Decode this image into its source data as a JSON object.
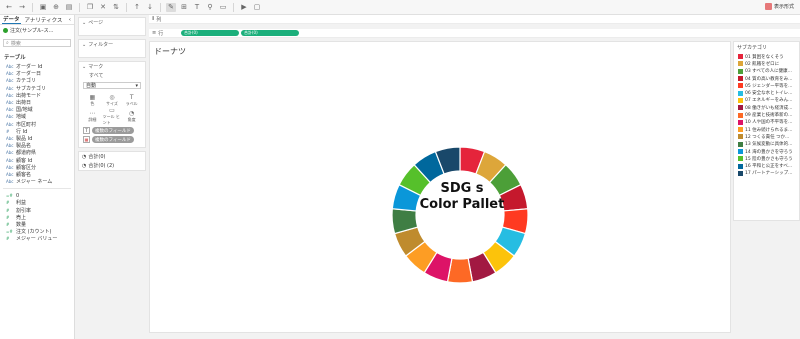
{
  "toolbar": {
    "buttons": [
      "back-icon",
      "forward-icon",
      "save-icon",
      "add-datasource-icon",
      "new-sheet-icon",
      "duplicate-icon",
      "clear-icon",
      "swap-icon",
      "sort-asc-icon",
      "sort-desc-icon",
      "highlight-icon",
      "group-icon",
      "label-icon",
      "fix-axes-icon",
      "fit-icon",
      "present-icon",
      "tooltip-icon"
    ],
    "show_me": "表示形式"
  },
  "data_pane": {
    "tabs": [
      "データ",
      "アナリティクス"
    ],
    "source": "注文(サンプル-ス...",
    "search_placeholder": "検索",
    "table_heading": "テーブル",
    "dimensions": [
      {
        "icon": "Abc",
        "label": "オーダー Id"
      },
      {
        "icon": "Abc",
        "label": "オーダー日"
      },
      {
        "icon": "Abc",
        "label": "カテゴリ"
      },
      {
        "icon": "Abc",
        "label": "サブカテゴリ"
      },
      {
        "icon": "Abc",
        "label": "出荷モード"
      },
      {
        "icon": "Abc",
        "label": "出荷日"
      },
      {
        "icon": "Abc",
        "label": "国/地域"
      },
      {
        "icon": "Abc",
        "label": "地域"
      },
      {
        "icon": "Abc",
        "label": "市区町村"
      },
      {
        "icon": "#",
        "label": "行 Id"
      },
      {
        "icon": "Abc",
        "label": "製品 Id"
      },
      {
        "icon": "Abc",
        "label": "製品名"
      },
      {
        "icon": "Abc",
        "label": "都道府県"
      },
      {
        "icon": "Abc",
        "label": "顧客 Id"
      },
      {
        "icon": "Abc",
        "label": "顧客区分"
      },
      {
        "icon": "Abc",
        "label": "顧客名"
      },
      {
        "icon": "Abc",
        "label": "メジャー ネーム"
      }
    ],
    "measures": [
      {
        "icon": "=#",
        "label": "0"
      },
      {
        "icon": "#",
        "label": "利益"
      },
      {
        "icon": "#",
        "label": "割引率"
      },
      {
        "icon": "#",
        "label": "売上"
      },
      {
        "icon": "#",
        "label": "数量"
      },
      {
        "icon": "=#",
        "label": "注文 (カウント)"
      },
      {
        "icon": "#",
        "label": "メジャー バリュー"
      }
    ]
  },
  "shelves": {
    "pages": "ページ",
    "filters": "フィルター",
    "marks": "マーク",
    "marks_all": "すべて",
    "mark_type": "自動",
    "mark_buttons": [
      {
        "sym": "▦",
        "label": "色"
      },
      {
        "sym": "◎",
        "label": "サイズ"
      },
      {
        "sym": "T",
        "label": "ラベル"
      },
      {
        "sym": "⋯",
        "label": "詳細"
      },
      {
        "sym": "▭",
        "label": "ツール ヒント"
      },
      {
        "sym": "◔",
        "label": "角度"
      }
    ],
    "pill1": "複数のフィールド",
    "pill2": "複数のフィールド",
    "sum1": "合計(0)",
    "sum2": "合計(0) (2)",
    "columns_label": "列",
    "rows_label": "行",
    "rows_pills": [
      "合計(0)",
      "合計(0)"
    ]
  },
  "sheet": {
    "title": "ドーナツ",
    "center_line1": "SDG s",
    "center_line2": "Color Pallet"
  },
  "legend": {
    "title": "サブカテゴリ",
    "items": [
      {
        "label": "01 貧困をなくそう",
        "color": "#e5243b"
      },
      {
        "label": "02 飢餓をゼロに",
        "color": "#dda63a"
      },
      {
        "label": "03 すべての人に健康...",
        "color": "#4c9f38"
      },
      {
        "label": "04 質の高い教育をみ...",
        "color": "#c5192d"
      },
      {
        "label": "05 ジェンダー平等を...",
        "color": "#ff3a21"
      },
      {
        "label": "06 安全な水とトイレ...",
        "color": "#26bde2"
      },
      {
        "label": "07 エネルギーをみん...",
        "color": "#fcc30b"
      },
      {
        "label": "08 働きがいも経済成...",
        "color": "#a21942"
      },
      {
        "label": "09 産業と技術革新の...",
        "color": "#fd6925"
      },
      {
        "label": "10 人や国の不平等を...",
        "color": "#dd1367"
      },
      {
        "label": "11 住み続けられるま...",
        "color": "#fd9d24"
      },
      {
        "label": "12 つくる責任  つか...",
        "color": "#bf8b2e"
      },
      {
        "label": "13 気候変動に具体的...",
        "color": "#3f7e44"
      },
      {
        "label": "14 海の豊かさを守ろう",
        "color": "#0a97d9"
      },
      {
        "label": "15 陸の豊かさも守ろう",
        "color": "#56c02b"
      },
      {
        "label": "16 平和と公正をすべ...",
        "color": "#00689d"
      },
      {
        "label": "17 パートナーシップ...",
        "color": "#19486a"
      }
    ]
  },
  "chart_data": {
    "type": "pie",
    "categories": [
      "01",
      "02",
      "03",
      "04",
      "05",
      "06",
      "07",
      "08",
      "09",
      "10",
      "11",
      "12",
      "13",
      "14",
      "15",
      "16",
      "17"
    ],
    "values": [
      1,
      1,
      1,
      1,
      1,
      1,
      1,
      1,
      1,
      1,
      1,
      1,
      1,
      1,
      1,
      1,
      1
    ],
    "title": "ドーナツ"
  }
}
